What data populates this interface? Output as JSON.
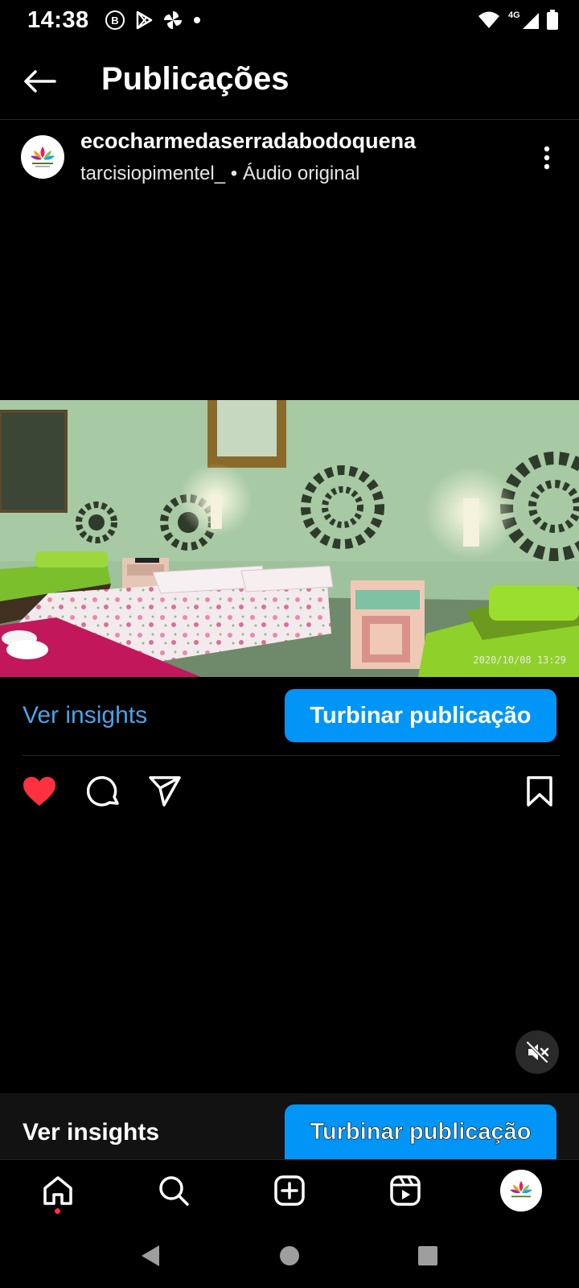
{
  "status_bar": {
    "time": "14:38",
    "network": "4G",
    "left_icons": [
      "b-badge-icon",
      "play-store-icon",
      "pinwheel-icon",
      "dot-icon"
    ],
    "right_icons": [
      "wifi-icon",
      "signal-icon",
      "battery-icon"
    ]
  },
  "header": {
    "title": "Publicações",
    "back_icon": "arrow-left-icon"
  },
  "post": {
    "username": "ecocharmedaserradabodoquena",
    "author": "tarcisiopimentel_",
    "separator": "•",
    "audio": "Áudio original",
    "media_timestamp": "2020/10/08  13:29",
    "media_description_colors": {
      "wall": "#9dbf9a",
      "bedspread": "#f2e6ea",
      "green_sheet": "#8fd12a",
      "red_blanket": "#c2185b"
    },
    "insights_label": "Ver insights",
    "boost_label": "Turbinar publicação",
    "liked": true,
    "actions": [
      "heart-icon",
      "comment-icon",
      "share-icon",
      "bookmark-icon"
    ]
  },
  "sticky_bar": {
    "insights_label": "Ver insights",
    "boost_label": "Turbinar publicação"
  },
  "bottom_nav": {
    "items": [
      "home-icon",
      "search-icon",
      "create-icon",
      "reels-icon",
      "profile-avatar"
    ]
  },
  "colors": {
    "accent": "#0095f6",
    "link": "#4aa3e8",
    "like": "#ff3040",
    "background": "#000000"
  }
}
